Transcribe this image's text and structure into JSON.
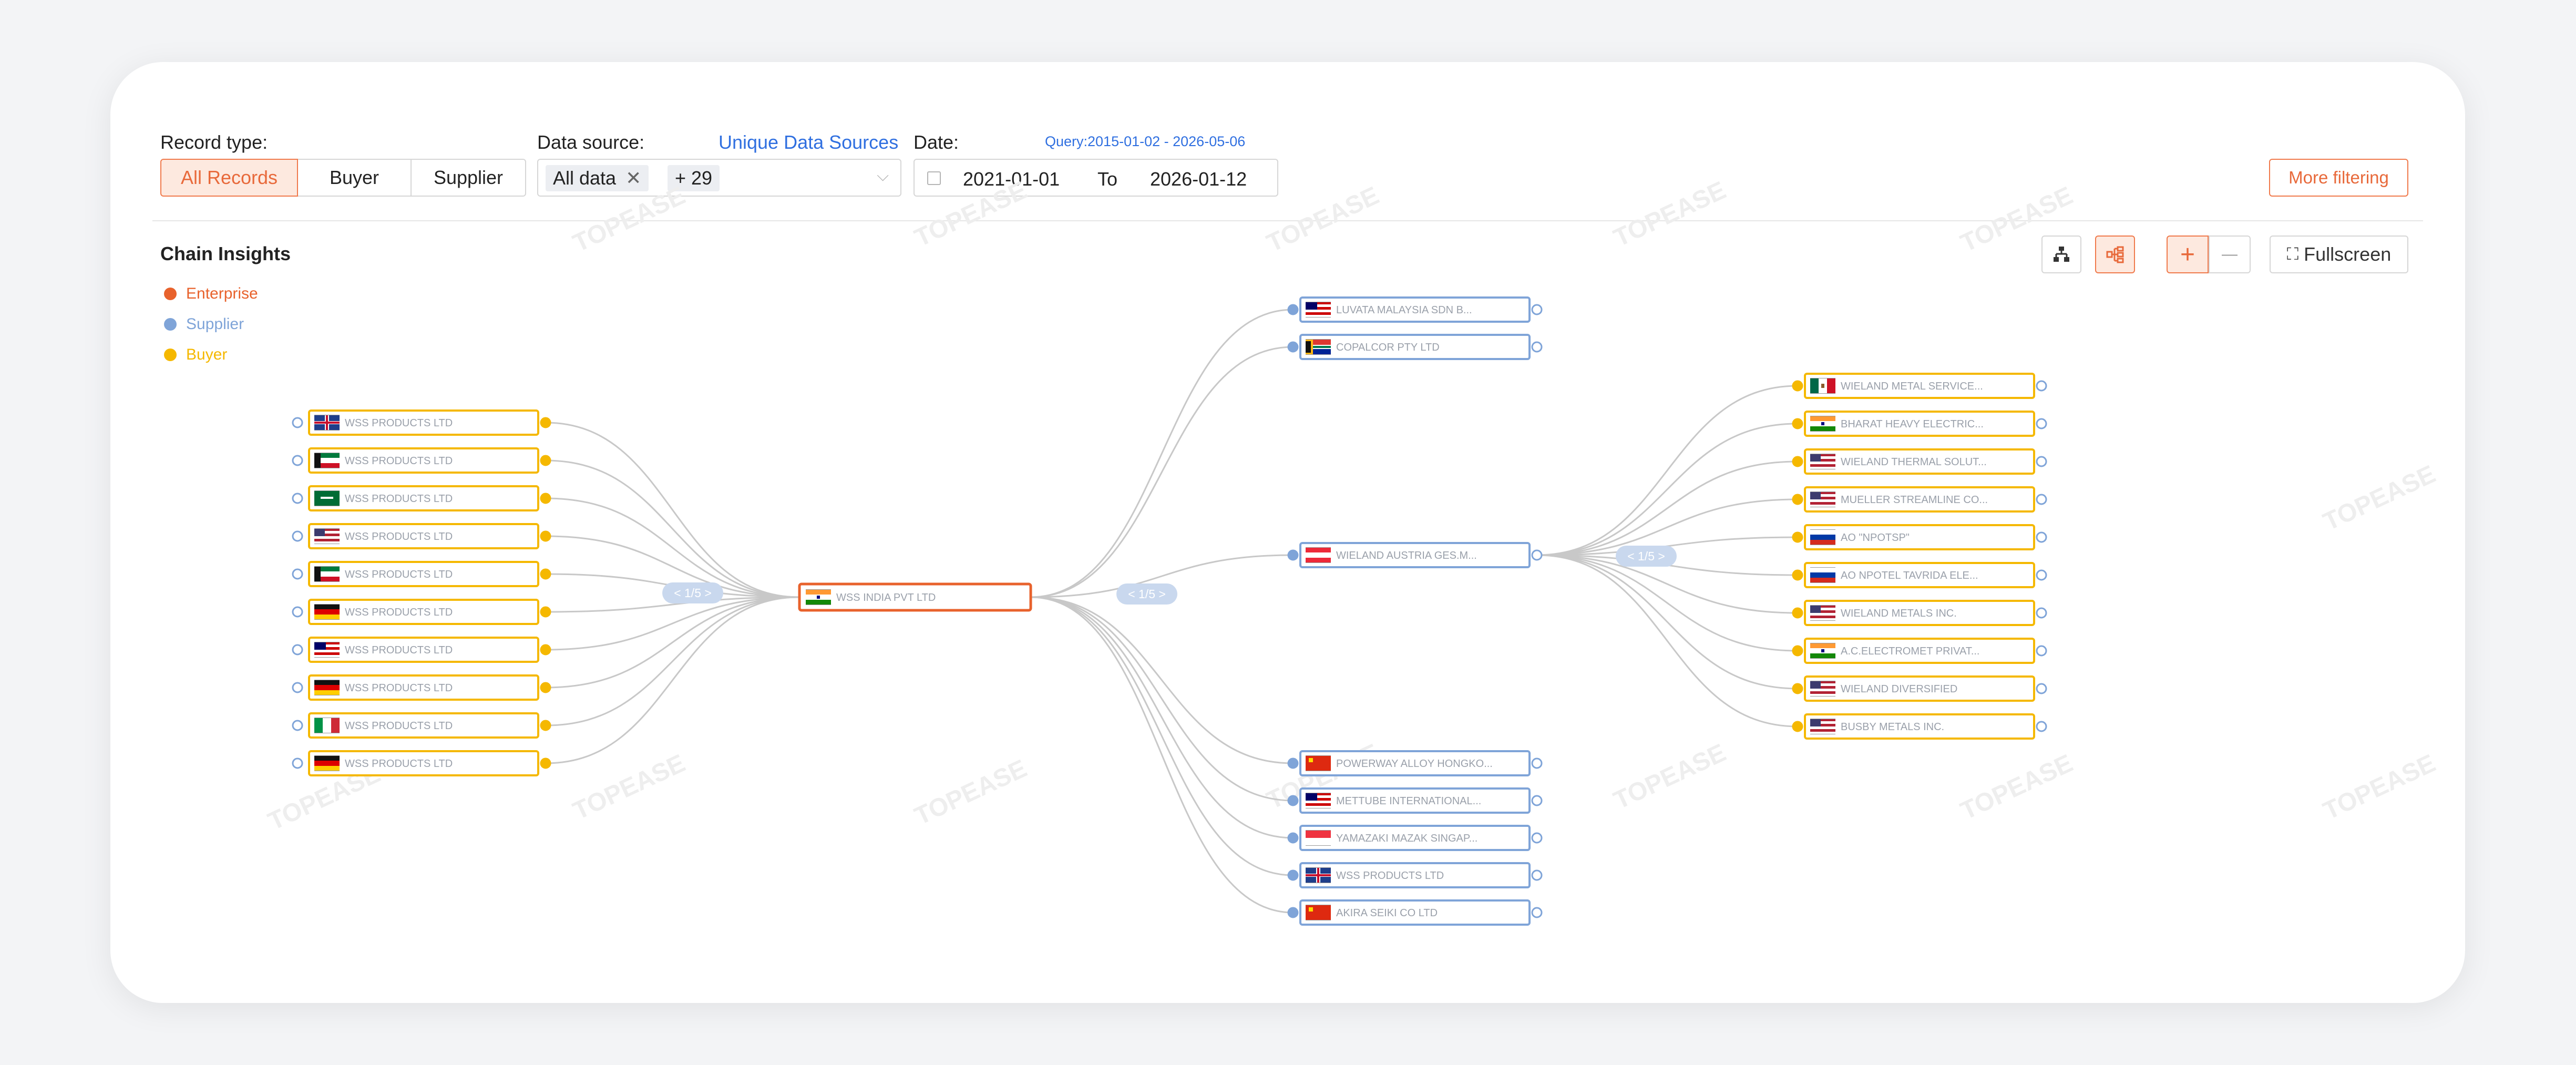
{
  "filters": {
    "record_type_label": "Record type:",
    "record_types": [
      "All Records",
      "Buyer",
      "Supplier"
    ],
    "data_source_label": "Data source:",
    "unique_sources_link": "Unique Data Sources",
    "data_source_tags": [
      "All data",
      "+ 29"
    ],
    "date_label": "Date:",
    "query_range": "Query:2015-01-02 - 2026-05-06",
    "date_from": "2021-01-01",
    "date_to_label": "To",
    "date_to": "2026-01-12",
    "more_filtering": "More filtering"
  },
  "panel": {
    "title": "Chain Insights",
    "legend": [
      {
        "label": "Enterprise",
        "color": "#e8622c"
      },
      {
        "label": "Supplier",
        "color": "#7fa4d8"
      },
      {
        "label": "Buyer",
        "color": "#f5b800"
      }
    ],
    "toolbar": {
      "tree_icon": "org-tree-icon",
      "mindmap_icon": "mindmap-icon",
      "zoom_in": "+",
      "zoom_out": "—",
      "fullscreen": "Fullscreen"
    },
    "watermark": "TOPEASE"
  },
  "graph": {
    "colors": {
      "enterprise": "#e8622c",
      "supplier": "#7fa4d8",
      "buyer": "#f5b800",
      "edge": "#c8c8c8",
      "node_text": "#9aa0aa",
      "pager_bg": "#c9d8ee"
    },
    "center": {
      "name": "WSS INDIA PVT LTD",
      "flag": "in"
    },
    "left_pager": "< 1/5 >",
    "right_pager": "< 1/5 >",
    "sub_pager": "< 1/5 >",
    "left_buyers": [
      {
        "name": "WSS PRODUCTS LTD",
        "flag": "gb"
      },
      {
        "name": "WSS PRODUCTS LTD",
        "flag": "kw"
      },
      {
        "name": "WSS PRODUCTS LTD",
        "flag": "sa"
      },
      {
        "name": "WSS PRODUCTS LTD",
        "flag": "us"
      },
      {
        "name": "WSS PRODUCTS LTD",
        "flag": "kw"
      },
      {
        "name": "WSS PRODUCTS LTD",
        "flag": "de"
      },
      {
        "name": "WSS PRODUCTS LTD",
        "flag": "my"
      },
      {
        "name": "WSS PRODUCTS LTD",
        "flag": "de"
      },
      {
        "name": "WSS PRODUCTS LTD",
        "flag": "it"
      },
      {
        "name": "WSS PRODUCTS LTD",
        "flag": "de"
      }
    ],
    "right_suppliers": [
      {
        "name": "LUVATA MALAYSIA SDN B...",
        "flag": "my"
      },
      {
        "name": "COPALCOR PTY LTD",
        "flag": "za"
      },
      {
        "name": "WIELAND AUSTRIA GES.M...",
        "flag": "at"
      },
      {
        "name": "POWERWAY ALLOY HONGKO...",
        "flag": "cn"
      },
      {
        "name": "METTUBE INTERNATIONAL...",
        "flag": "my"
      },
      {
        "name": "YAMAZAKI MAZAK SINGAP...",
        "flag": "sg"
      },
      {
        "name": "WSS PRODUCTS LTD",
        "flag": "gb"
      },
      {
        "name": "AKIRA SEIKI CO LTD",
        "flag": "cn"
      }
    ],
    "sub_buyers": [
      {
        "name": "WIELAND METAL SERVICE...",
        "flag": "mx"
      },
      {
        "name": "BHARAT HEAVY ELECTRIC...",
        "flag": "in"
      },
      {
        "name": "WIELAND THERMAL SOLUT...",
        "flag": "us"
      },
      {
        "name": "MUELLER STREAMLINE CO...",
        "flag": "us"
      },
      {
        "name": "AO \"NPOTSP\"",
        "flag": "ru"
      },
      {
        "name": "AO NPOTEL TAVRIDA ELE...",
        "flag": "ru"
      },
      {
        "name": "WIELAND METALS INC.",
        "flag": "us"
      },
      {
        "name": "A.C.ELECTROMET PRIVAT...",
        "flag": "in"
      },
      {
        "name": "WIELAND DIVERSIFIED",
        "flag": "us"
      },
      {
        "name": "BUSBY METALS INC.",
        "flag": "us"
      }
    ]
  }
}
